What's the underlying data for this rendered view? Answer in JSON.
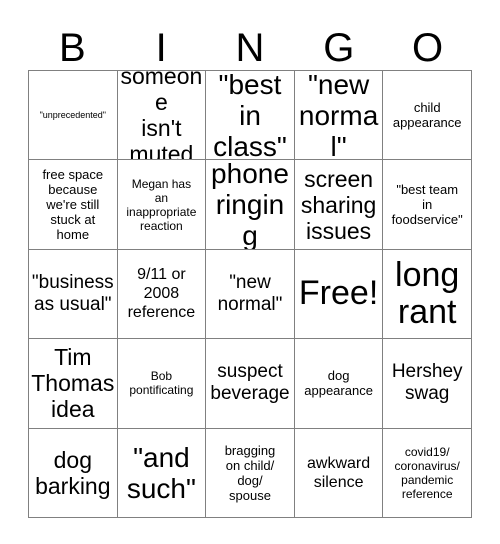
{
  "card": {
    "title": "BINGO",
    "header_letters": [
      "B",
      "I",
      "N",
      "G",
      "O"
    ],
    "columns": 5,
    "rows": 5,
    "free_space_label": "Free!",
    "colors": {
      "background": "#ffffff",
      "text": "#000000",
      "grid_line": "#808080"
    },
    "cells": [
      {
        "text": "\"unprecedented\"",
        "size": "fs-xxs",
        "row": 1,
        "col": 1
      },
      {
        "text": "someone\nisn't\nmuted",
        "size": "fs-xl",
        "row": 1,
        "col": 2
      },
      {
        "text": "\"best in\nclass\"",
        "size": "fs-xxl",
        "row": 1,
        "col": 3
      },
      {
        "text": "\"new\nnormal\"",
        "size": "fs-xxl",
        "row": 1,
        "col": 4
      },
      {
        "text": "child\nappearance",
        "size": "fs-s",
        "row": 1,
        "col": 5
      },
      {
        "text": "free space\nbecause\nwe're still\nstuck at\nhome",
        "size": "fs-s",
        "row": 2,
        "col": 1
      },
      {
        "text": "Megan has\nan\ninappropriate\nreaction",
        "size": "fs-xs",
        "row": 2,
        "col": 2
      },
      {
        "text": "phone\nringing",
        "size": "fs-xxl",
        "row": 2,
        "col": 3
      },
      {
        "text": "screen\nsharing\nissues",
        "size": "fs-xl",
        "row": 2,
        "col": 4
      },
      {
        "text": "\"best team\nin\nfoodservice\"",
        "size": "fs-s",
        "row": 2,
        "col": 5
      },
      {
        "text": "\"business\nas usual\"",
        "size": "fs-l",
        "row": 3,
        "col": 1
      },
      {
        "text": "9/11 or\n2008\nreference",
        "size": "fs-m",
        "row": 3,
        "col": 2
      },
      {
        "text": "\"new\nnormal\"",
        "size": "fs-l",
        "row": 3,
        "col": 3
      },
      {
        "text": "Free!",
        "size": "fs-h",
        "row": 3,
        "col": 4
      },
      {
        "text": "long\nrant",
        "size": "fs-h",
        "row": 3,
        "col": 5
      },
      {
        "text": "Tim\nThomas\nidea",
        "size": "fs-xl",
        "row": 4,
        "col": 1
      },
      {
        "text": "Bob\npontificating",
        "size": "fs-xs",
        "row": 4,
        "col": 2
      },
      {
        "text": "suspect\nbeverage",
        "size": "fs-l",
        "row": 4,
        "col": 3
      },
      {
        "text": "dog\nappearance",
        "size": "fs-s",
        "row": 4,
        "col": 4
      },
      {
        "text": "Hershey\nswag",
        "size": "fs-l",
        "row": 4,
        "col": 5
      },
      {
        "text": "dog\nbarking",
        "size": "fs-xl",
        "row": 5,
        "col": 1
      },
      {
        "text": "\"and\nsuch\"",
        "size": "fs-xxl",
        "row": 5,
        "col": 2
      },
      {
        "text": "bragging\non child/\ndog/\nspouse",
        "size": "fs-s",
        "row": 5,
        "col": 3
      },
      {
        "text": "awkward\nsilence",
        "size": "fs-m",
        "row": 5,
        "col": 4
      },
      {
        "text": "covid19/\ncoronavirus/\npandemic\nreference",
        "size": "fs-xs",
        "row": 5,
        "col": 5
      }
    ]
  }
}
